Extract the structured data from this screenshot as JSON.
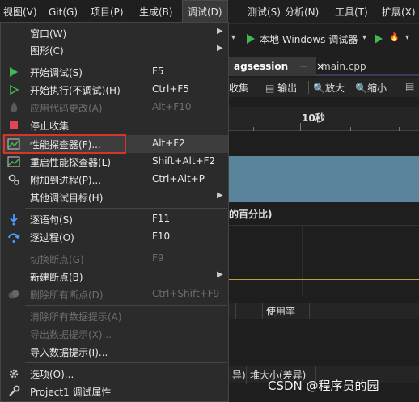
{
  "menubar": {
    "items": [
      "视图(V)",
      "Git(G)",
      "项目(P)",
      "生成(B)",
      "调试(D)",
      "测试(S)",
      "分析(N)",
      "工具(T)",
      "扩展(X)"
    ]
  },
  "toolbar": {
    "run_target": "本地 Windows 调试器"
  },
  "tabs": {
    "active": "agsession",
    "pin": "⊣",
    "close": "×",
    "other": "main.cpp"
  },
  "profiler_toolbar": {
    "collect": "收集",
    "output": "输出",
    "zoom_in": "放大",
    "zoom_out": "缩小"
  },
  "timeline": {
    "tick_label": "10秒",
    "cpu_label": "的百分比)"
  },
  "bottom": {
    "usage": "使用率",
    "col_a": "异)",
    "col_b": "堆大小(差异)"
  },
  "watermark": "CSDN @程序员的园",
  "debug_menu": {
    "items": [
      {
        "label": "窗口(W)",
        "shortcut": "",
        "submenu": true,
        "icon": "",
        "disabled": false
      },
      {
        "label": "图形(C)",
        "shortcut": "",
        "submenu": true,
        "icon": "",
        "disabled": false
      },
      {
        "label": "开始调试(S)",
        "shortcut": "F5",
        "submenu": false,
        "icon": "play-icon",
        "disabled": false
      },
      {
        "label": "开始执行(不调试)(H)",
        "shortcut": "Ctrl+F5",
        "submenu": false,
        "icon": "play-outline-icon",
        "disabled": false
      },
      {
        "label": "应用代码更改(A)",
        "shortcut": "Alt+F10",
        "submenu": false,
        "icon": "flame-icon",
        "disabled": true
      },
      {
        "label": "停止收集",
        "shortcut": "",
        "submenu": false,
        "icon": "stop-icon",
        "disabled": false
      },
      {
        "label": "性能探查器(F)...",
        "shortcut": "Alt+F2",
        "submenu": false,
        "icon": "performance-profiler-icon",
        "disabled": false
      },
      {
        "label": "重启性能探查器(L)",
        "shortcut": "Shift+Alt+F2",
        "submenu": false,
        "icon": "restart-profiler-icon",
        "disabled": false
      },
      {
        "label": "附加到进程(P)...",
        "shortcut": "Ctrl+Alt+P",
        "submenu": false,
        "icon": "attach-gear-icon",
        "disabled": false
      },
      {
        "label": "其他调试目标(H)",
        "shortcut": "",
        "submenu": true,
        "icon": "",
        "disabled": false
      },
      {
        "label": "逐语句(S)",
        "shortcut": "F11",
        "submenu": false,
        "icon": "step-into-icon",
        "disabled": false
      },
      {
        "label": "逐过程(O)",
        "shortcut": "F10",
        "submenu": false,
        "icon": "step-over-icon",
        "disabled": false
      },
      {
        "label": "切换断点(G)",
        "shortcut": "F9",
        "submenu": false,
        "icon": "",
        "disabled": true
      },
      {
        "label": "新建断点(B)",
        "shortcut": "",
        "submenu": true,
        "icon": "",
        "disabled": false
      },
      {
        "label": "删除所有断点(D)",
        "shortcut": "Ctrl+Shift+F9",
        "submenu": false,
        "icon": "delete-breakpoints-icon",
        "disabled": true
      },
      {
        "label": "清除所有数据提示(A)",
        "shortcut": "",
        "submenu": false,
        "icon": "",
        "disabled": true
      },
      {
        "label": "导出数据提示(X)...",
        "shortcut": "",
        "submenu": false,
        "icon": "",
        "disabled": true
      },
      {
        "label": "导入数据提示(I)...",
        "shortcut": "",
        "submenu": false,
        "icon": "",
        "disabled": false
      },
      {
        "label": "选项(O)...",
        "shortcut": "",
        "submenu": false,
        "icon": "gear-icon",
        "disabled": false
      },
      {
        "label": "Project1 调试属性",
        "shortcut": "",
        "submenu": false,
        "icon": "wrench-icon",
        "disabled": false
      }
    ]
  },
  "colors": {
    "accent_green": "#3fb950",
    "highlight_red": "#d9342b",
    "cpu_band": "#5a849c",
    "stop_red": "#e0445a"
  }
}
